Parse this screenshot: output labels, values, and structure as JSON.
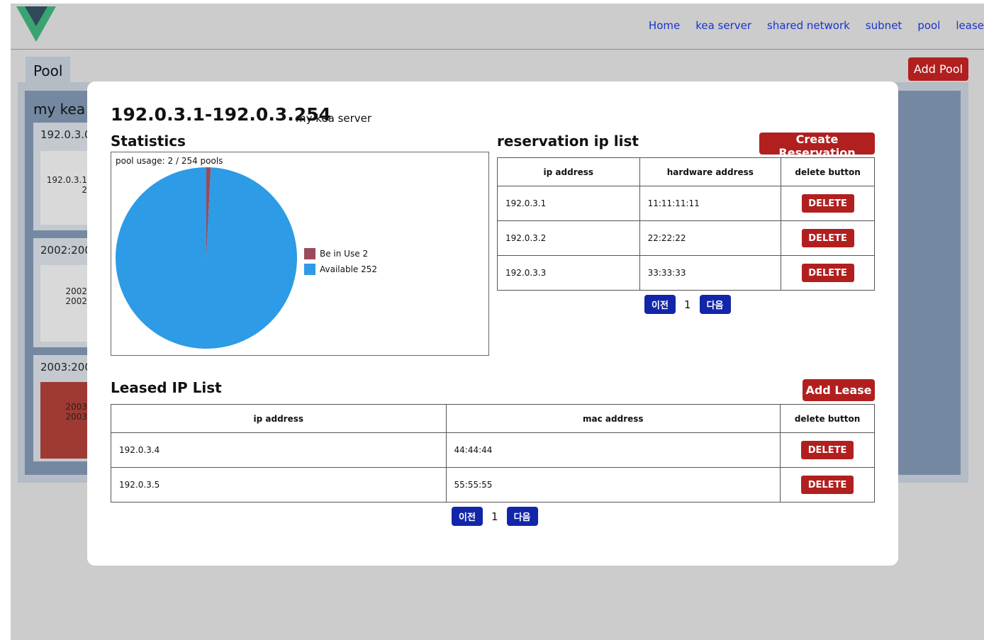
{
  "nav": {
    "items": [
      "Home",
      "kea server",
      "shared network",
      "subnet",
      "pool",
      "lease"
    ]
  },
  "page": {
    "tab_label": "Pool",
    "add_pool_label": "Add Pool",
    "server_name": "my kea s",
    "subnets": [
      {
        "label": "192.0.3.0/",
        "pool_lines": [
          "192.0.3.1",
          "2"
        ]
      },
      {
        "label": "2002:200",
        "pool_lines": [
          "2002",
          "2002"
        ]
      },
      {
        "label": "2003:200",
        "pool_lines": [
          "2003",
          "2003"
        ]
      }
    ]
  },
  "modal": {
    "title": "192.0.3.1-192.0.3.254",
    "subtitle": "my kea server",
    "statistics_title": "Statistics",
    "reservation_title": "reservation ip list",
    "create_reservation_label": "Create Reservation",
    "leased_title": "Leased IP List",
    "add_lease_label": "Add Lease",
    "delete_label": "DELETE",
    "reservation_headers": [
      "ip address",
      "hardware address",
      "delete button"
    ],
    "reservations": [
      {
        "ip": "192.0.3.1",
        "hw": "11:11:11:11"
      },
      {
        "ip": "192.0.3.2",
        "hw": "22:22:22"
      },
      {
        "ip": "192.0.3.3",
        "hw": "33:33:33"
      }
    ],
    "lease_headers": [
      "ip address",
      "mac address",
      "delete button"
    ],
    "leases": [
      {
        "ip": "192.0.3.4",
        "mac": "44:44:44"
      },
      {
        "ip": "192.0.3.5",
        "mac": "55:55:55"
      }
    ],
    "pager": {
      "prev": "이전",
      "page": "1",
      "next": "다음"
    }
  },
  "chart_data": {
    "type": "pie",
    "title": "pool usage: 2 / 254 pools",
    "legend_position": "right",
    "slices": [
      {
        "label": "Be in Use",
        "value": 2,
        "color": "#9b4a5c"
      },
      {
        "label": "Available",
        "value": 252,
        "color": "#2d9be6"
      }
    ]
  },
  "colors": {
    "accent_red": "#b21f1f",
    "pager_blue": "#1226aa",
    "nav_link": "#1a33cc",
    "logo_green": "#3aa372",
    "logo_dark": "#2f4a58"
  }
}
